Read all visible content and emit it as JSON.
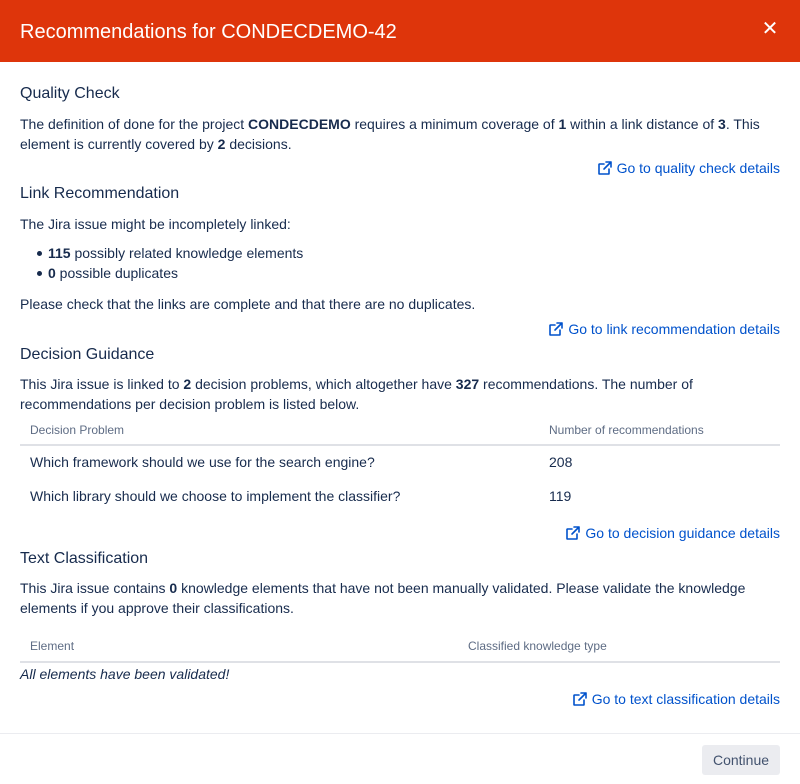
{
  "dialog": {
    "title": "Recommendations for CONDECDEMO-42",
    "close_glyph": "✕"
  },
  "quality": {
    "heading": "Quality Check",
    "text_1": "The definition of done for the project ",
    "project": "CONDECDEMO",
    "text_2": " requires a minimum coverage of ",
    "min_coverage": "1",
    "text_3": " within a link distance of ",
    "link_distance": "3",
    "text_4": ". This element is currently covered by ",
    "covered_by": "2",
    "text_5": " decisions.",
    "link": "Go to quality check details"
  },
  "link_rec": {
    "heading": "Link Recommendation",
    "intro": "The Jira issue might be incompletely linked:",
    "items": [
      {
        "count": "115",
        "label": " possibly related knowledge elements"
      },
      {
        "count": "0",
        "label": " possible duplicates"
      }
    ],
    "note": "Please check that the links are complete and that there are no duplicates.",
    "link": "Go to link recommendation details"
  },
  "guidance": {
    "heading": "Decision Guidance",
    "text_1": "This Jira issue is linked to ",
    "problems": "2",
    "text_2": " decision problems, which altogether have ",
    "recommendations": "327",
    "text_3": " recommendations. The number of recommendations per decision problem is listed below.",
    "col_problem": "Decision Problem",
    "col_count": "Number of recommendations",
    "rows": [
      {
        "problem": "Which framework should we use for the search engine?",
        "count": "208"
      },
      {
        "problem": "Which library should we choose to implement the classifier?",
        "count": "119"
      }
    ],
    "link": "Go to decision guidance details"
  },
  "classification": {
    "heading": "Text Classification",
    "text_1": "This Jira issue contains ",
    "count": "0",
    "text_2": " knowledge elements that have not been manually validated. Please validate the knowledge elements if you approve their classifications.",
    "col_element": "Element",
    "col_type": "Classified knowledge type",
    "empty": "All elements have been validated!",
    "link": "Go to text classification details"
  },
  "footer": {
    "continue_label": "Continue"
  },
  "colors": {
    "header": "#de350b",
    "link": "#0052cc",
    "text": "#172b4d"
  }
}
